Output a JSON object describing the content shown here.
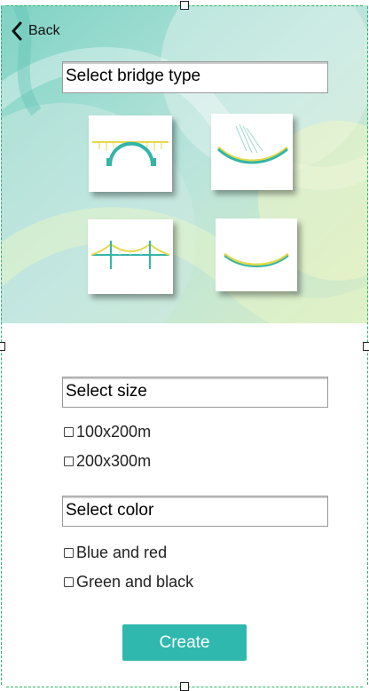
{
  "nav": {
    "back_label": "Back"
  },
  "bridge_section": {
    "title": "Select bridge type",
    "options": [
      {
        "icon": "arch-bridge-icon"
      },
      {
        "icon": "cable-stayed-bridge-icon"
      },
      {
        "icon": "suspension-bridge-icon"
      },
      {
        "icon": "curved-deck-bridge-icon"
      }
    ]
  },
  "size_section": {
    "title": "Select size",
    "options": [
      {
        "label": "100x200m",
        "checked": false
      },
      {
        "label": "200x300m",
        "checked": false
      }
    ]
  },
  "color_section": {
    "title": "Select color",
    "options": [
      {
        "label": "Blue and red",
        "checked": false
      },
      {
        "label": "Green and black",
        "checked": false
      }
    ]
  },
  "create_label": "Create",
  "colors": {
    "accent": "#2fb8ad",
    "hero_tint": "#a9ddd2",
    "bridge_teal": "#33b5a8",
    "bridge_yellow": "#e6d84a"
  }
}
